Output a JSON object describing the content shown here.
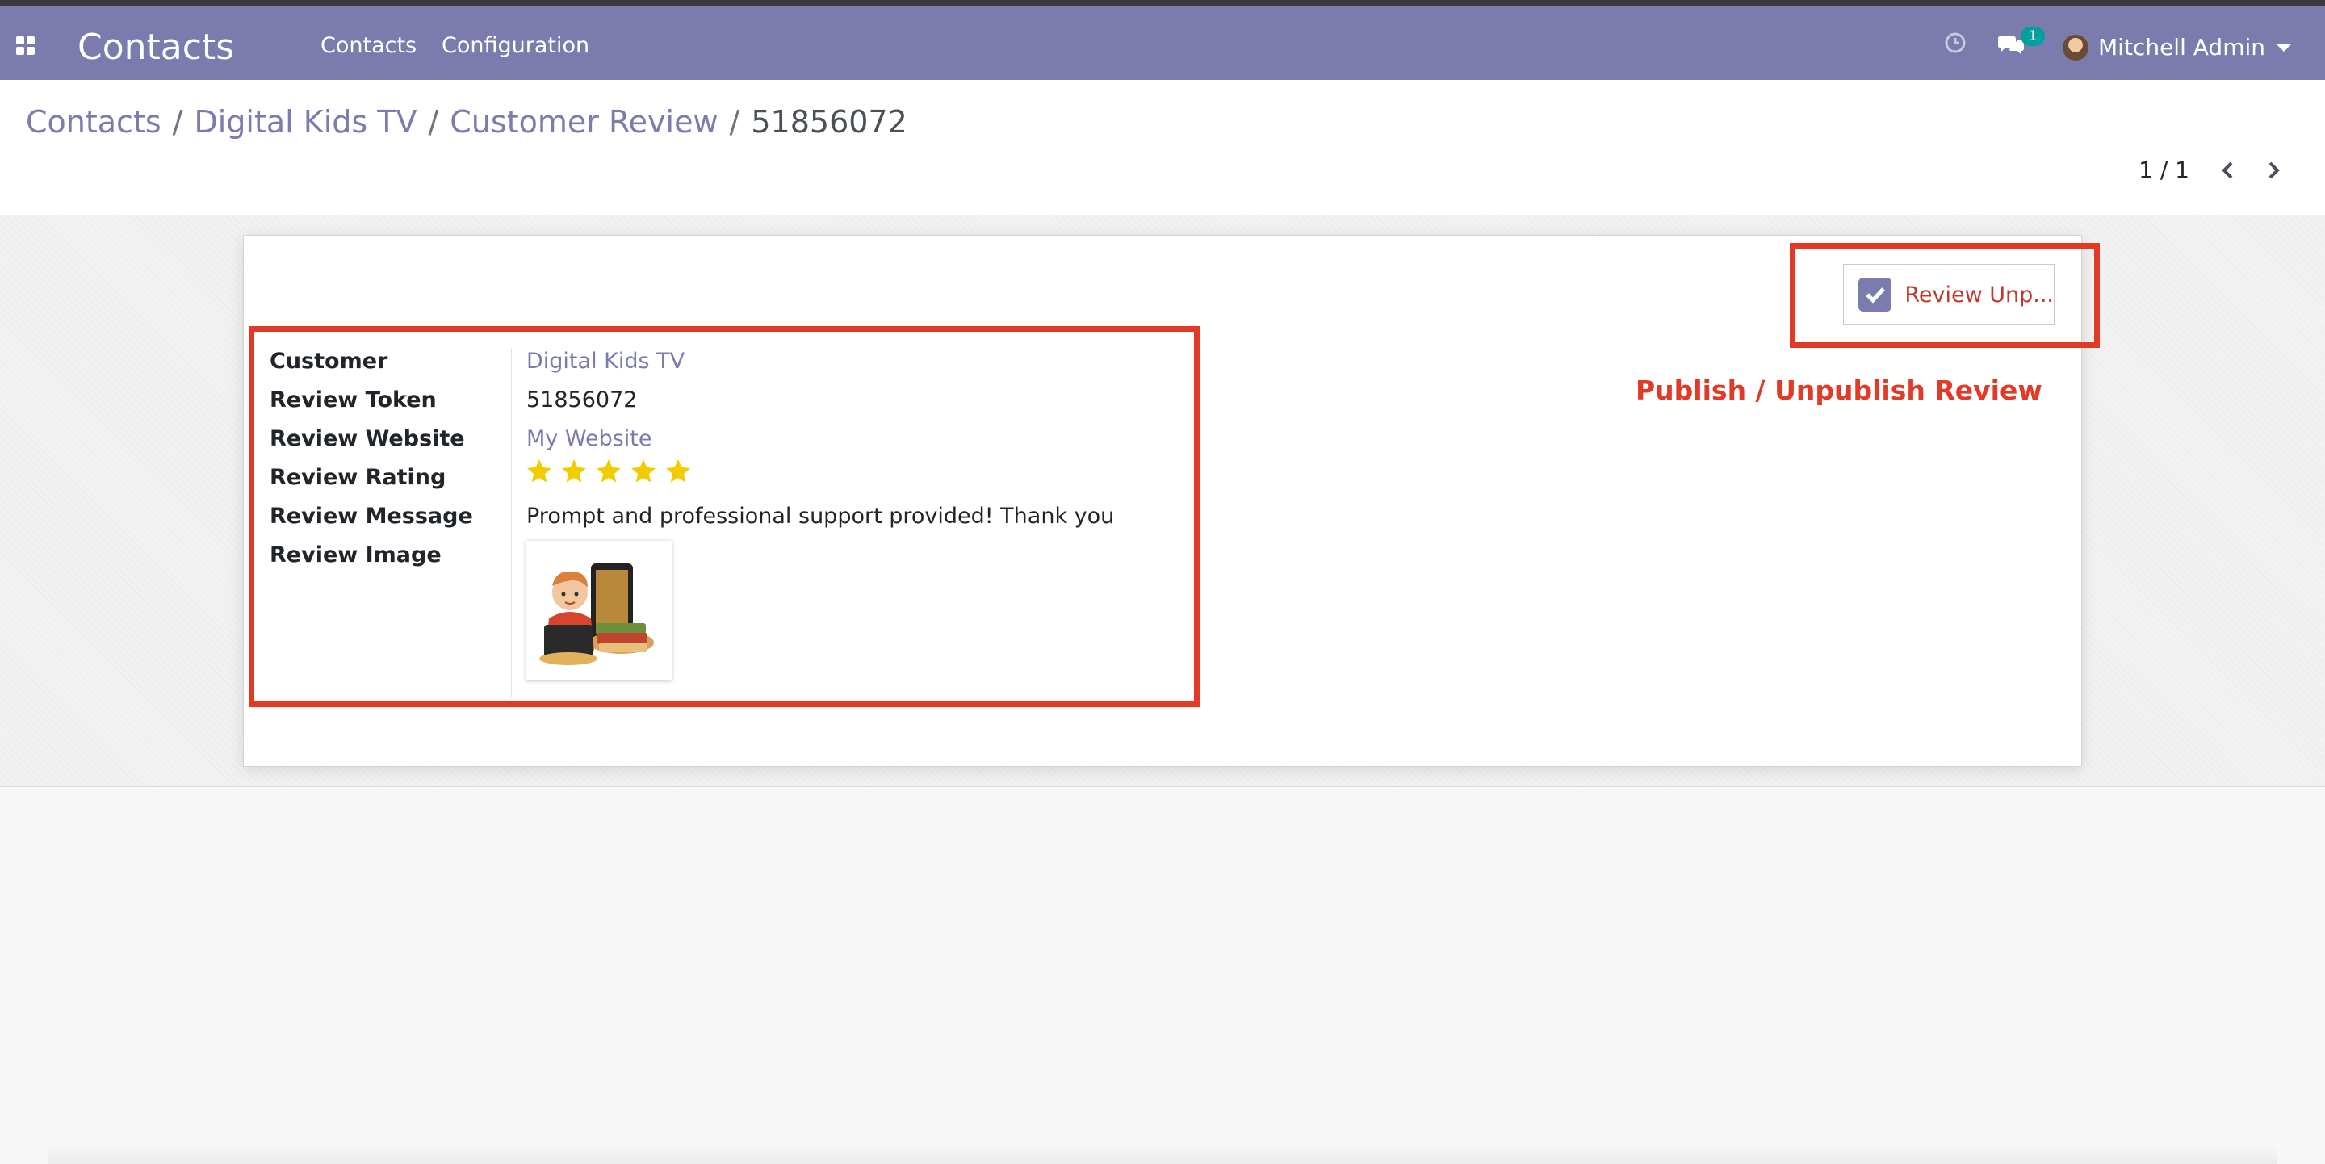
{
  "navbar": {
    "app_title": "Contacts",
    "menu": [
      "Contacts",
      "Configuration"
    ],
    "messages_count": "1",
    "user_name": "Mitchell Admin",
    "color": "#7c7bad"
  },
  "breadcrumb": [
    "Contacts",
    "Digital Kids TV",
    "Customer Review",
    "51856072"
  ],
  "pager": {
    "value": "1 / 1"
  },
  "publish_button": {
    "label": "Review Unp...",
    "checked": true
  },
  "annotation": {
    "text": "Publish / Unpublish Review",
    "color": "#e23a26"
  },
  "fields": {
    "customer": {
      "label": "Customer",
      "value": "Digital Kids TV"
    },
    "token": {
      "label": "Review Token",
      "value": "51856072"
    },
    "website": {
      "label": "Review Website",
      "value": "My Website"
    },
    "rating": {
      "label": "Review Rating",
      "stars": 5,
      "max": 5
    },
    "message": {
      "label": "Review Message",
      "value": "Prompt and professional support provided! Thank you"
    },
    "image": {
      "label": "Review Image"
    }
  },
  "icons": [
    "apps-icon",
    "clock-icon",
    "chat-icon",
    "chevron-left-icon",
    "chevron-right-icon",
    "check-icon",
    "star-icon"
  ]
}
